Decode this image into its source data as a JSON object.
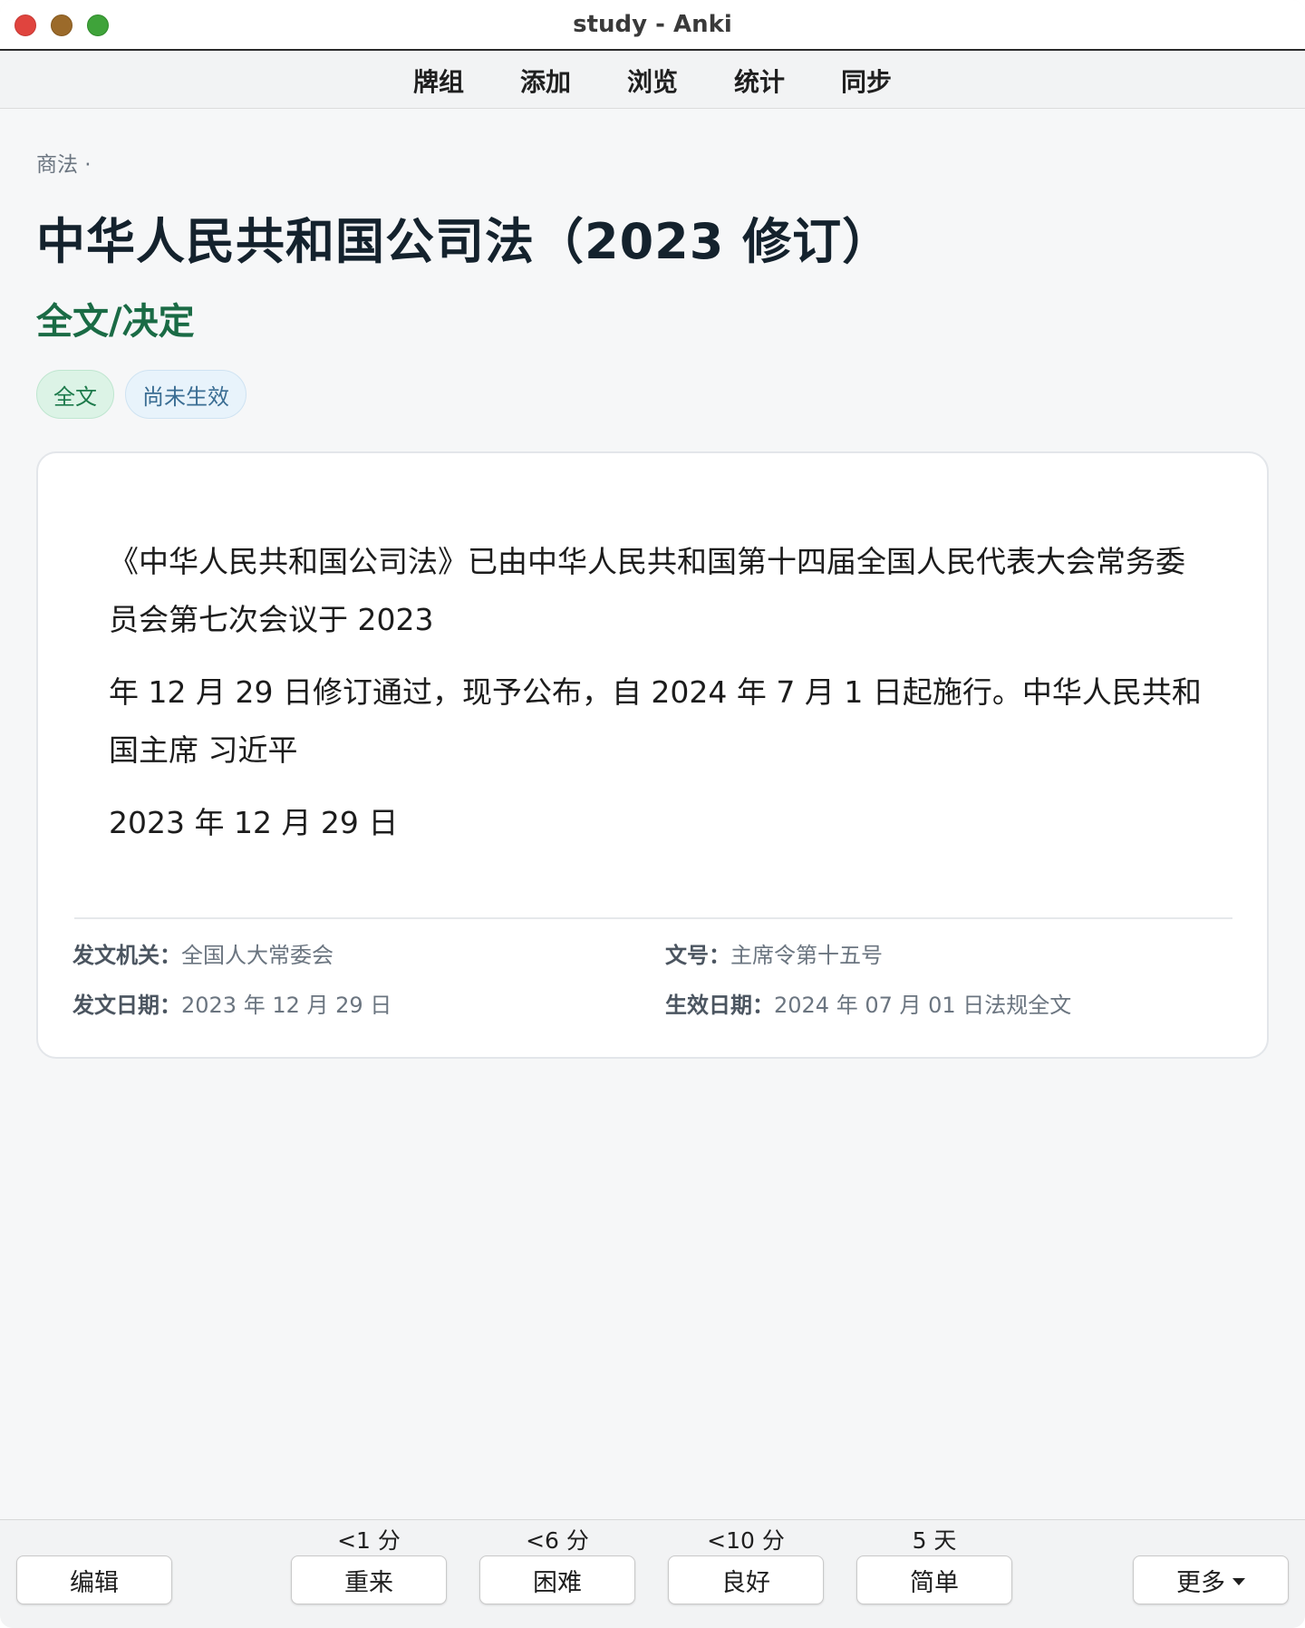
{
  "window": {
    "title": "study - Anki"
  },
  "topnav": {
    "items": [
      "牌组",
      "添加",
      "浏览",
      "统计",
      "同步"
    ]
  },
  "breadcrumb": "商法 ·",
  "page_title": "中华人民共和国公司法（2023 修订）",
  "section_title": "全文/决定",
  "tags": [
    {
      "label": "全文",
      "color": "#dcf3e6"
    },
    {
      "label": "尚未生效",
      "color": "#e8f3fb"
    }
  ],
  "card": {
    "paragraphs": [
      "《中华人民共和国公司法》已由中华人民共和国第十四届全国人民代表大会常务委员会第七次会议于 2023",
      "年 12 月 29 日修订通过，现予公布，自 2024 年 7 月 1 日起施行。中华人民共和国主席 习近平",
      "2023 年 12 月 29 日"
    ],
    "meta": {
      "issuer_label": "发文机关：",
      "issuer": "全国人大常委会",
      "doc_no_label": "文号：",
      "doc_no": "主席令第十五号",
      "issue_date_label": "发文日期：",
      "issue_date": "2023 年 12 月 29 日",
      "effective_date_label": "生效日期：",
      "effective_date": "2024 年 07 月 01 日法规全文"
    }
  },
  "bottom": {
    "edit_label": "编辑",
    "answers": [
      {
        "interval": "<1 分",
        "label": "重来"
      },
      {
        "interval": "<6 分",
        "label": "困难"
      },
      {
        "interval": "<10 分",
        "label": "良好"
      },
      {
        "interval": "5 天",
        "label": "简单"
      }
    ],
    "more_label": "更多"
  },
  "colors": {
    "accent_green": "#1a6b45",
    "title": "#14222d"
  }
}
